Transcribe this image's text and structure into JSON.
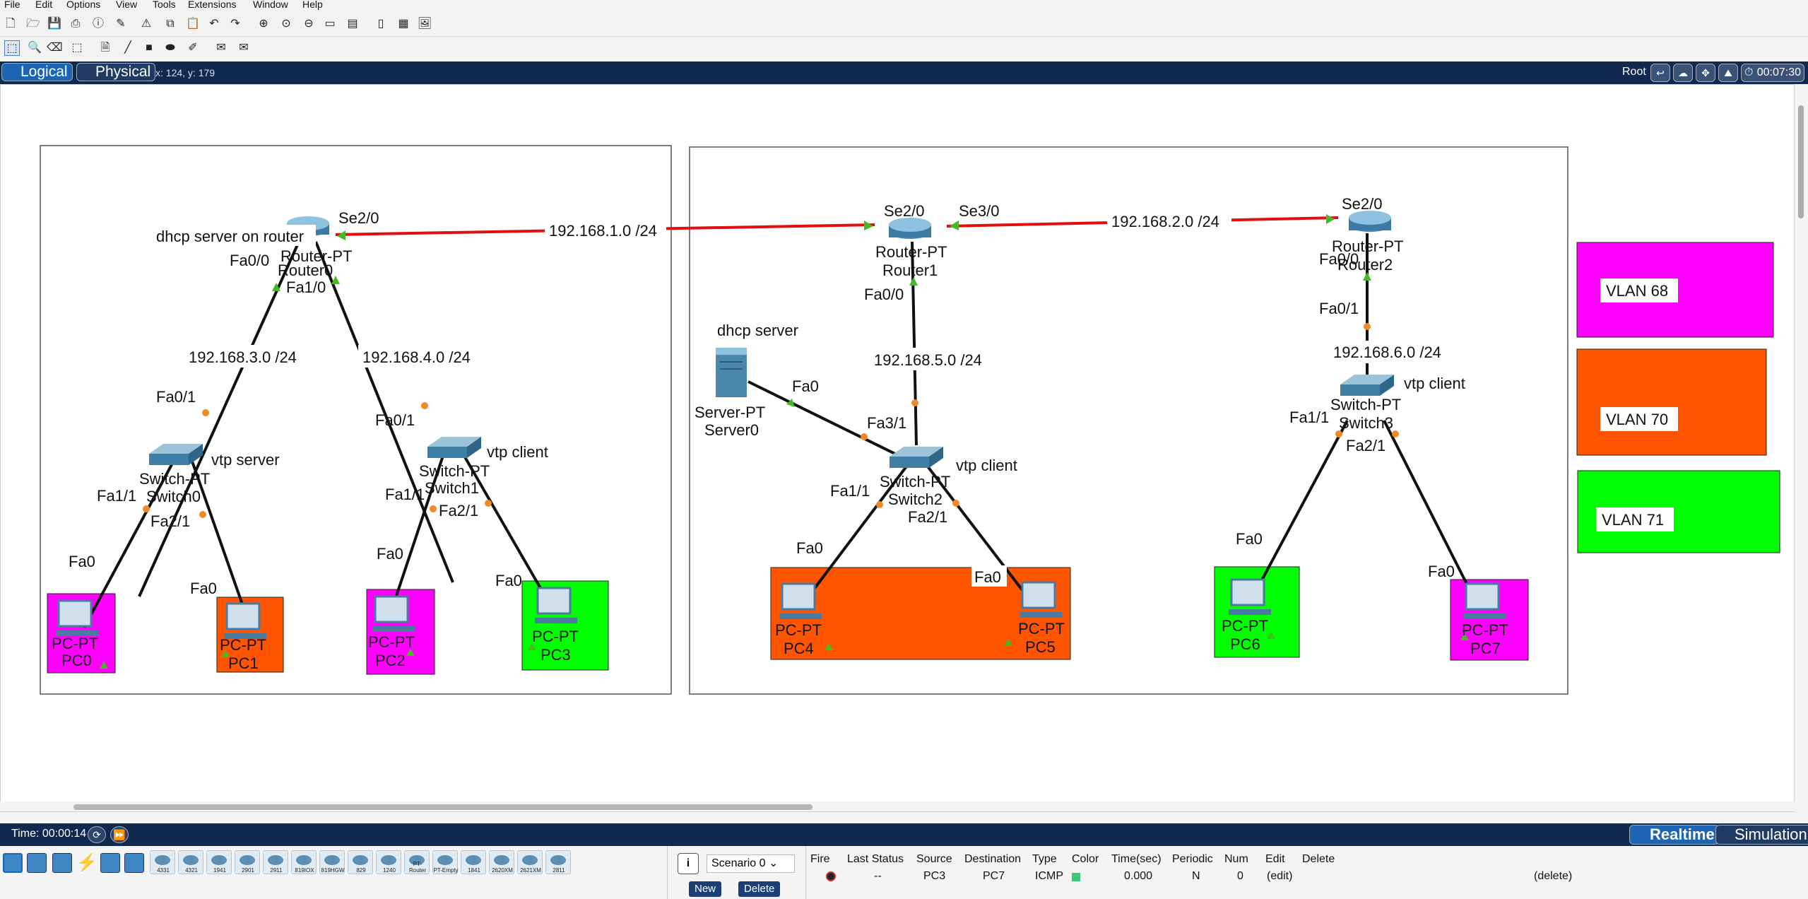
{
  "menu": [
    "File",
    "Edit",
    "Options",
    "View",
    "Tools",
    "Extensions",
    "Window",
    "Help"
  ],
  "help_label": "?",
  "mode": {
    "logical": "Logical",
    "physical": "Physical",
    "coords": "x: 124, y: 179"
  },
  "root_label": "Root",
  "clock": "00:07:30",
  "status": {
    "time": "Time: 00:00:14",
    "realtime": "Realtime",
    "simulation": "Simulation"
  },
  "topology": {
    "routers": [
      {
        "name": "Router-PT",
        "host": "Router0"
      },
      {
        "name": "Router-PT",
        "host": "Router1"
      },
      {
        "name": "Router-PT",
        "host": "Router2"
      }
    ],
    "switches": [
      {
        "name": "Switch-PT",
        "host": "Switch0",
        "note": "vtp server"
      },
      {
        "name": "Switch-PT",
        "host": "Switch1",
        "note": "vtp client"
      },
      {
        "name": "Switch-PT",
        "host": "Switch2",
        "note": "vtp client"
      },
      {
        "name": "Switch-PT",
        "host": "Switch3",
        "note": "vtp client"
      }
    ],
    "server": {
      "name": "Server-PT",
      "host": "Server0",
      "note": "dhcp server"
    },
    "pcs": [
      {
        "name": "PC-PT",
        "host": "PC0",
        "vlan": "VLAN 68"
      },
      {
        "name": "PC-PT",
        "host": "PC1",
        "vlan": "VLAN 70"
      },
      {
        "name": "PC-PT",
        "host": "PC2",
        "vlan": "VLAN 68"
      },
      {
        "name": "PC-PT",
        "host": "PC3",
        "vlan": "VLAN 71"
      },
      {
        "name": "PC-PT",
        "host": "PC4",
        "vlan": "VLAN 70"
      },
      {
        "name": "PC-PT",
        "host": "PC5",
        "vlan": "VLAN 70"
      },
      {
        "name": "PC-PT",
        "host": "PC6",
        "vlan": "VLAN 71"
      },
      {
        "name": "PC-PT",
        "host": "PC7",
        "vlan": "VLAN 68"
      }
    ],
    "notes": {
      "router0": "dhcp server on router",
      "net1": "192.168.1.0 /24",
      "net2": "192.168.2.0 /24",
      "net3": "192.168.3.0 /24",
      "net4": "192.168.4.0 /24",
      "net5": "192.168.5.0 /24",
      "net6": "192.168.6.0 /24"
    },
    "ports": {
      "se20": "Se2/0",
      "se30": "Se3/0",
      "fa00": "Fa0/0",
      "fa10": "Fa1/0",
      "fa01": "Fa0/1",
      "fa11": "Fa1/1",
      "fa21": "Fa2/1",
      "fa31": "Fa3/1",
      "fa0": "Fa0"
    },
    "legend": [
      {
        "label": "VLAN 68",
        "color": "#ff00ff"
      },
      {
        "label": "VLAN 70",
        "color": "#ff5500"
      },
      {
        "label": "VLAN 71",
        "color": "#00ff00"
      }
    ]
  },
  "device_models": [
    "4331",
    "4321",
    "1941",
    "2901",
    "2911",
    "819IOX",
    "819HGW",
    "829",
    "1240",
    "PT-Router",
    "PT-Empty",
    "1841",
    "2620XM",
    "2621XM",
    "2811"
  ],
  "scenario": {
    "selected": "Scenario 0",
    "new": "New",
    "delete": "Delete"
  },
  "pdu_table": {
    "headers": [
      "Fire",
      "Last Status",
      "Source",
      "Destination",
      "Type",
      "Color",
      "Time(sec)",
      "Periodic",
      "Num",
      "Edit",
      "Delete"
    ],
    "rows": [
      {
        "last_status": "--",
        "source": "PC3",
        "destination": "PC7",
        "type": "ICMP",
        "color": "#3cc87a",
        "time": "0.000",
        "periodic": "N",
        "num": "0",
        "edit": "(edit)",
        "delete": "(delete)"
      }
    ]
  }
}
